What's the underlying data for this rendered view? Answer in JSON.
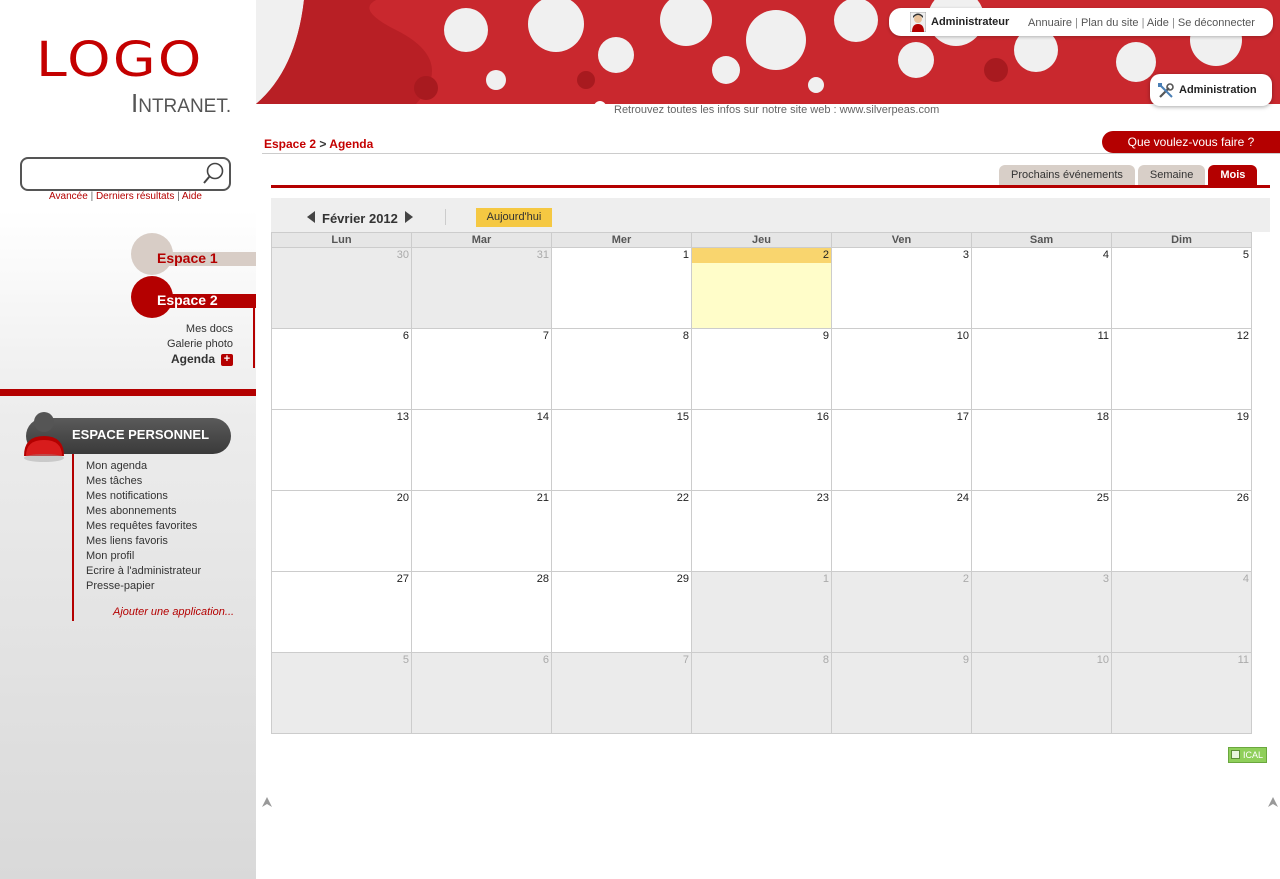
{
  "logo": {
    "main": "LOGO",
    "sub_initial": "I",
    "sub_rest": "NTRANET."
  },
  "search": {
    "value": "",
    "links": [
      "Avancée",
      "Derniers résultats",
      "Aide"
    ]
  },
  "spaces": {
    "espace1": "Espace 1",
    "espace2": "Espace 2",
    "espace2_items": [
      "Mes docs",
      "Galerie photo",
      "Agenda"
    ]
  },
  "personal": {
    "title": "ESPACE PERSONNEL",
    "items": [
      "Mon agenda",
      "Mes tâches",
      "Mes notifications",
      "Mes abonnements",
      "Mes requêtes favorites",
      "Mes liens favoris",
      "Mon profil",
      "Ecrire à l'administrateur",
      "Presse-papier"
    ],
    "add_app": "Ajouter une application..."
  },
  "header": {
    "user_name": "Administrateur",
    "links": [
      "Annuaire",
      "Plan du site",
      "Aide",
      "Se déconnecter"
    ],
    "admin_label": "Administration",
    "tagline": "Retrouvez toutes les infos sur notre site web : www.silverpeas.com"
  },
  "breadcrumb": {
    "space": "Espace 2",
    "separator": ">",
    "page": "Agenda"
  },
  "action_button": "Que voulez-vous faire ?",
  "tabs": [
    "Prochains événements",
    "Semaine",
    "Mois"
  ],
  "calendar": {
    "month_title": "Février 2012",
    "today_label": "Aujourd'hui",
    "weekdays": [
      "Lun",
      "Mar",
      "Mer",
      "Jeu",
      "Ven",
      "Sam",
      "Dim"
    ],
    "weeks": [
      [
        {
          "d": "30",
          "o": true
        },
        {
          "d": "31",
          "o": true
        },
        {
          "d": "1"
        },
        {
          "d": "2",
          "t": true
        },
        {
          "d": "3"
        },
        {
          "d": "4"
        },
        {
          "d": "5"
        }
      ],
      [
        {
          "d": "6"
        },
        {
          "d": "7"
        },
        {
          "d": "8"
        },
        {
          "d": "9"
        },
        {
          "d": "10"
        },
        {
          "d": "11"
        },
        {
          "d": "12"
        }
      ],
      [
        {
          "d": "13"
        },
        {
          "d": "14"
        },
        {
          "d": "15"
        },
        {
          "d": "16"
        },
        {
          "d": "17"
        },
        {
          "d": "18"
        },
        {
          "d": "19"
        }
      ],
      [
        {
          "d": "20"
        },
        {
          "d": "21"
        },
        {
          "d": "22"
        },
        {
          "d": "23"
        },
        {
          "d": "24"
        },
        {
          "d": "25"
        },
        {
          "d": "26"
        }
      ],
      [
        {
          "d": "27"
        },
        {
          "d": "28"
        },
        {
          "d": "29"
        },
        {
          "d": "1",
          "o": true
        },
        {
          "d": "2",
          "o": true
        },
        {
          "d": "3",
          "o": true
        },
        {
          "d": "4",
          "o": true
        }
      ],
      [
        {
          "d": "5",
          "o": true
        },
        {
          "d": "6",
          "o": true
        },
        {
          "d": "7",
          "o": true
        },
        {
          "d": "8",
          "o": true
        },
        {
          "d": "9",
          "o": true
        },
        {
          "d": "10",
          "o": true
        },
        {
          "d": "11",
          "o": true
        }
      ]
    ]
  },
  "ical_label": "ICAL",
  "colors": {
    "brand": "#b40000",
    "today_header": "#f9d56e",
    "today_bg": "#fffdc9",
    "ical": "#8fcf5a"
  }
}
